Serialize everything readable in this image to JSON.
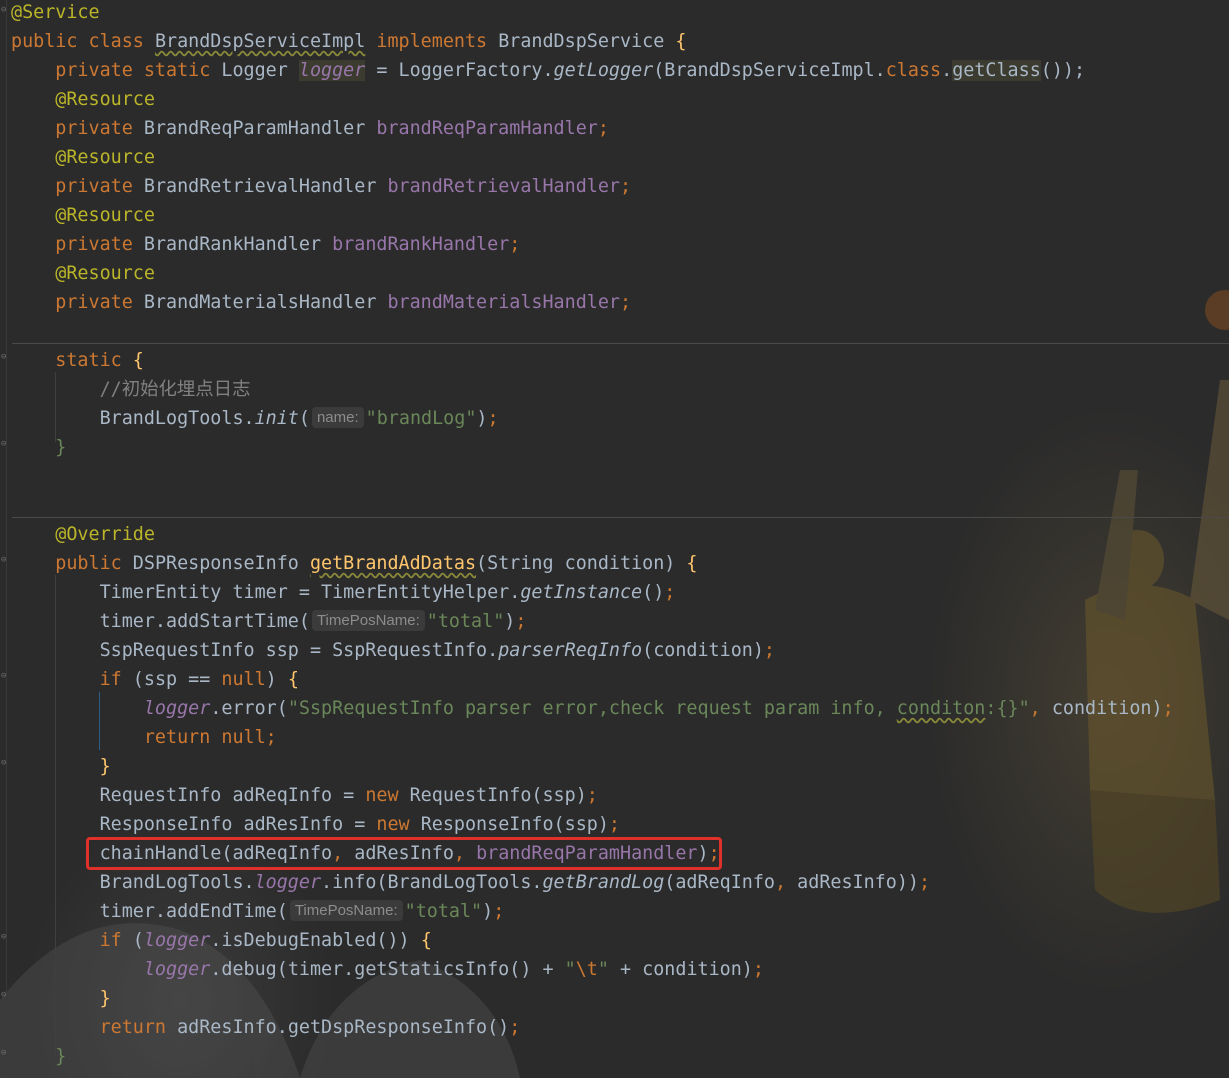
{
  "editor": {
    "theme": "Darcula",
    "highlight_color": "#e0302a",
    "lines": [
      {
        "id": "l1",
        "tokens": [
          [
            "ann",
            "@Service"
          ]
        ]
      },
      {
        "id": "l2",
        "tokens": [
          [
            "kw",
            "public class "
          ],
          [
            "plain-under",
            "BrandDspServiceImpl"
          ],
          [
            "kw",
            " implements "
          ],
          [
            "plain",
            "BrandDspService "
          ],
          [
            "method",
            "{"
          ]
        ]
      },
      {
        "id": "l3",
        "tokens": [
          [
            "kw",
            "    private static "
          ],
          [
            "plain",
            "Logger "
          ],
          [
            "field-i-hl",
            "logger"
          ],
          [
            "plain",
            " = LoggerFactory."
          ],
          [
            "static-i",
            "getLogger"
          ],
          [
            "plain",
            "(BrandDspServiceImpl."
          ],
          [
            "kw",
            "class"
          ],
          [
            "plain",
            "."
          ],
          [
            "plain-hl",
            "getClass"
          ],
          [
            "plain",
            "());"
          ]
        ]
      },
      {
        "id": "l4",
        "tokens": [
          [
            "ann",
            "    @Resource"
          ]
        ]
      },
      {
        "id": "l5",
        "tokens": [
          [
            "kw",
            "    private "
          ],
          [
            "plain",
            "BrandReqParamHandler "
          ],
          [
            "field",
            "brandReqParamHandler"
          ],
          [
            "punct",
            ";"
          ]
        ]
      },
      {
        "id": "l6",
        "tokens": [
          [
            "ann",
            "    @Resource"
          ]
        ]
      },
      {
        "id": "l7",
        "tokens": [
          [
            "kw",
            "    private "
          ],
          [
            "plain",
            "BrandRetrievalHandler "
          ],
          [
            "field",
            "brandRetrievalHandler"
          ],
          [
            "punct",
            ";"
          ]
        ]
      },
      {
        "id": "l8",
        "tokens": [
          [
            "ann",
            "    @Resource"
          ]
        ]
      },
      {
        "id": "l9",
        "tokens": [
          [
            "kw",
            "    private "
          ],
          [
            "plain",
            "BrandRankHandler "
          ],
          [
            "field",
            "brandRankHandler"
          ],
          [
            "punct",
            ";"
          ]
        ]
      },
      {
        "id": "l10",
        "tokens": [
          [
            "ann",
            "    @Resource"
          ]
        ]
      },
      {
        "id": "l11",
        "tokens": [
          [
            "kw",
            "    private "
          ],
          [
            "plain",
            "BrandMaterialsHandler "
          ],
          [
            "field",
            "brandMaterialsHandler"
          ],
          [
            "punct",
            ";"
          ]
        ]
      },
      {
        "id": "l12",
        "tokens": []
      },
      {
        "id": "l13",
        "tokens": [
          [
            "kw",
            "    static "
          ],
          [
            "method",
            "{"
          ]
        ]
      },
      {
        "id": "l14",
        "tokens": [
          [
            "com",
            "        //初始化埋点日志"
          ]
        ]
      },
      {
        "id": "l15",
        "tokens": [
          [
            "plain",
            "        BrandLogTools."
          ],
          [
            "static-i",
            "init"
          ],
          [
            "plain",
            "("
          ],
          [
            "hint",
            "name:"
          ],
          [
            "str",
            "\"brandLog\""
          ],
          [
            "plain",
            ")"
          ],
          [
            "punct",
            ";"
          ]
        ]
      },
      {
        "id": "l16",
        "tokens": [
          [
            "str",
            "    }"
          ]
        ]
      },
      {
        "id": "l17",
        "tokens": []
      },
      {
        "id": "l18",
        "tokens": []
      },
      {
        "id": "l19",
        "tokens": [
          [
            "ann",
            "    @Override"
          ]
        ]
      },
      {
        "id": "l20",
        "tokens": [
          [
            "kw",
            "    public "
          ],
          [
            "plain",
            "DSPResponseInfo "
          ],
          [
            "method-under",
            "getBrandAdDatas"
          ],
          [
            "plain",
            "(String condition) "
          ],
          [
            "method",
            "{"
          ]
        ]
      },
      {
        "id": "l21",
        "tokens": [
          [
            "plain",
            "        TimerEntity timer = TimerEntityHelper."
          ],
          [
            "static-i",
            "getInstance"
          ],
          [
            "plain",
            "()"
          ],
          [
            "punct",
            ";"
          ]
        ]
      },
      {
        "id": "l22",
        "tokens": [
          [
            "plain",
            "        timer.addStartTime("
          ],
          [
            "hint",
            "TimePosName:"
          ],
          [
            "str",
            "\"total\""
          ],
          [
            "plain",
            ")"
          ],
          [
            "punct",
            ";"
          ]
        ]
      },
      {
        "id": "l23",
        "tokens": [
          [
            "plain",
            "        SspRequestInfo ssp = SspRequestInfo."
          ],
          [
            "static-i",
            "parserReqInfo"
          ],
          [
            "plain",
            "(condition)"
          ],
          [
            "punct",
            ";"
          ]
        ]
      },
      {
        "id": "l24",
        "tokens": [
          [
            "kw",
            "        if "
          ],
          [
            "plain",
            "(ssp == "
          ],
          [
            "kw",
            "null"
          ],
          [
            "plain",
            ") "
          ],
          [
            "method",
            "{"
          ]
        ]
      },
      {
        "id": "l25",
        "tokens": [
          [
            "field-i",
            "            logger"
          ],
          [
            "plain",
            ".error("
          ],
          [
            "str",
            "\"SspRequestInfo parser error,check request param info, "
          ],
          [
            "str-under",
            "conditon"
          ],
          [
            "str",
            ":{}\""
          ],
          [
            "punct",
            ", "
          ],
          [
            "plain",
            "condition)"
          ],
          [
            "punct",
            ";"
          ]
        ]
      },
      {
        "id": "l26",
        "tokens": [
          [
            "kw",
            "            return null;"
          ]
        ]
      },
      {
        "id": "l27",
        "tokens": [
          [
            "method",
            "        }"
          ]
        ]
      },
      {
        "id": "l28",
        "tokens": [
          [
            "plain",
            "        RequestInfo adReqInfo = "
          ],
          [
            "kw",
            "new "
          ],
          [
            "plain",
            "RequestInfo(ssp)"
          ],
          [
            "punct",
            ";"
          ]
        ]
      },
      {
        "id": "l29",
        "tokens": [
          [
            "plain",
            "        ResponseInfo adResInfo = "
          ],
          [
            "kw",
            "new "
          ],
          [
            "plain",
            "ResponseInfo(ssp)"
          ],
          [
            "punct",
            ";"
          ]
        ]
      },
      {
        "id": "l30",
        "tokens": [
          [
            "plain",
            "        chainHandle(adReqInfo"
          ],
          [
            "punct",
            ", "
          ],
          [
            "plain",
            "adResInfo"
          ],
          [
            "punct",
            ", "
          ],
          [
            "field",
            "brandReqParamHandler"
          ],
          [
            "plain",
            ")"
          ],
          [
            "punct",
            ";"
          ]
        ]
      },
      {
        "id": "l31",
        "tokens": [
          [
            "plain",
            "        BrandLogTools."
          ],
          [
            "field-i",
            "logger"
          ],
          [
            "plain",
            ".info(BrandLogTools."
          ],
          [
            "static-i",
            "getBrandLog"
          ],
          [
            "plain",
            "(adReqInfo"
          ],
          [
            "punct",
            ", "
          ],
          [
            "plain",
            "adResInfo))"
          ],
          [
            "punct",
            ";"
          ]
        ]
      },
      {
        "id": "l32",
        "tokens": [
          [
            "plain",
            "        timer.addEndTime("
          ],
          [
            "hint",
            "TimePosName:"
          ],
          [
            "str",
            "\"total\""
          ],
          [
            "plain",
            ")"
          ],
          [
            "punct",
            ";"
          ]
        ]
      },
      {
        "id": "l33",
        "tokens": [
          [
            "kw",
            "        if "
          ],
          [
            "plain",
            "("
          ],
          [
            "field-i",
            "logger"
          ],
          [
            "plain",
            ".isDebugEnabled()) "
          ],
          [
            "method",
            "{"
          ]
        ]
      },
      {
        "id": "l34",
        "tokens": [
          [
            "field-i",
            "            logger"
          ],
          [
            "plain",
            ".debug(timer.getStaticsInfo() + "
          ],
          [
            "str",
            "\""
          ],
          [
            "esc",
            "\\t"
          ],
          [
            "str",
            "\""
          ],
          [
            "plain",
            " + condition)"
          ],
          [
            "punct",
            ";"
          ]
        ]
      },
      {
        "id": "l35",
        "tokens": [
          [
            "method",
            "        }"
          ]
        ]
      },
      {
        "id": "l36",
        "tokens": [
          [
            "kw",
            "        return "
          ],
          [
            "plain",
            "adResInfo.getDspResponseInfo()"
          ],
          [
            "punct",
            ";"
          ]
        ]
      },
      {
        "id": "l37",
        "tokens": [
          [
            "str",
            "    }"
          ]
        ]
      }
    ]
  }
}
